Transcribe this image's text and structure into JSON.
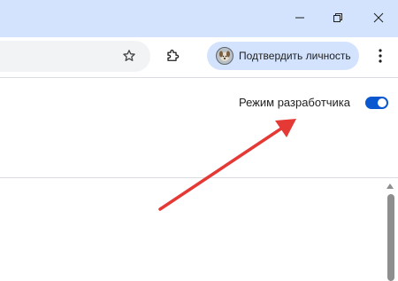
{
  "window_controls": {
    "minimize_icon": "minimize-icon",
    "restore_icon": "restore-icon",
    "close_icon": "close-icon"
  },
  "toolbar": {
    "bookmark_icon": "star-icon",
    "extensions_icon": "puzzle-icon",
    "profile": {
      "label": "Подтвердить личность",
      "avatar_icon": "dog-avatar-icon"
    },
    "menu_icon": "kebab-menu-icon"
  },
  "page": {
    "dev_mode_label": "Режим разработчика",
    "dev_mode_enabled": true
  },
  "colors": {
    "titlebar": "#d3e3fd",
    "accent": "#0b57d0",
    "annotation_arrow": "#e53935"
  }
}
